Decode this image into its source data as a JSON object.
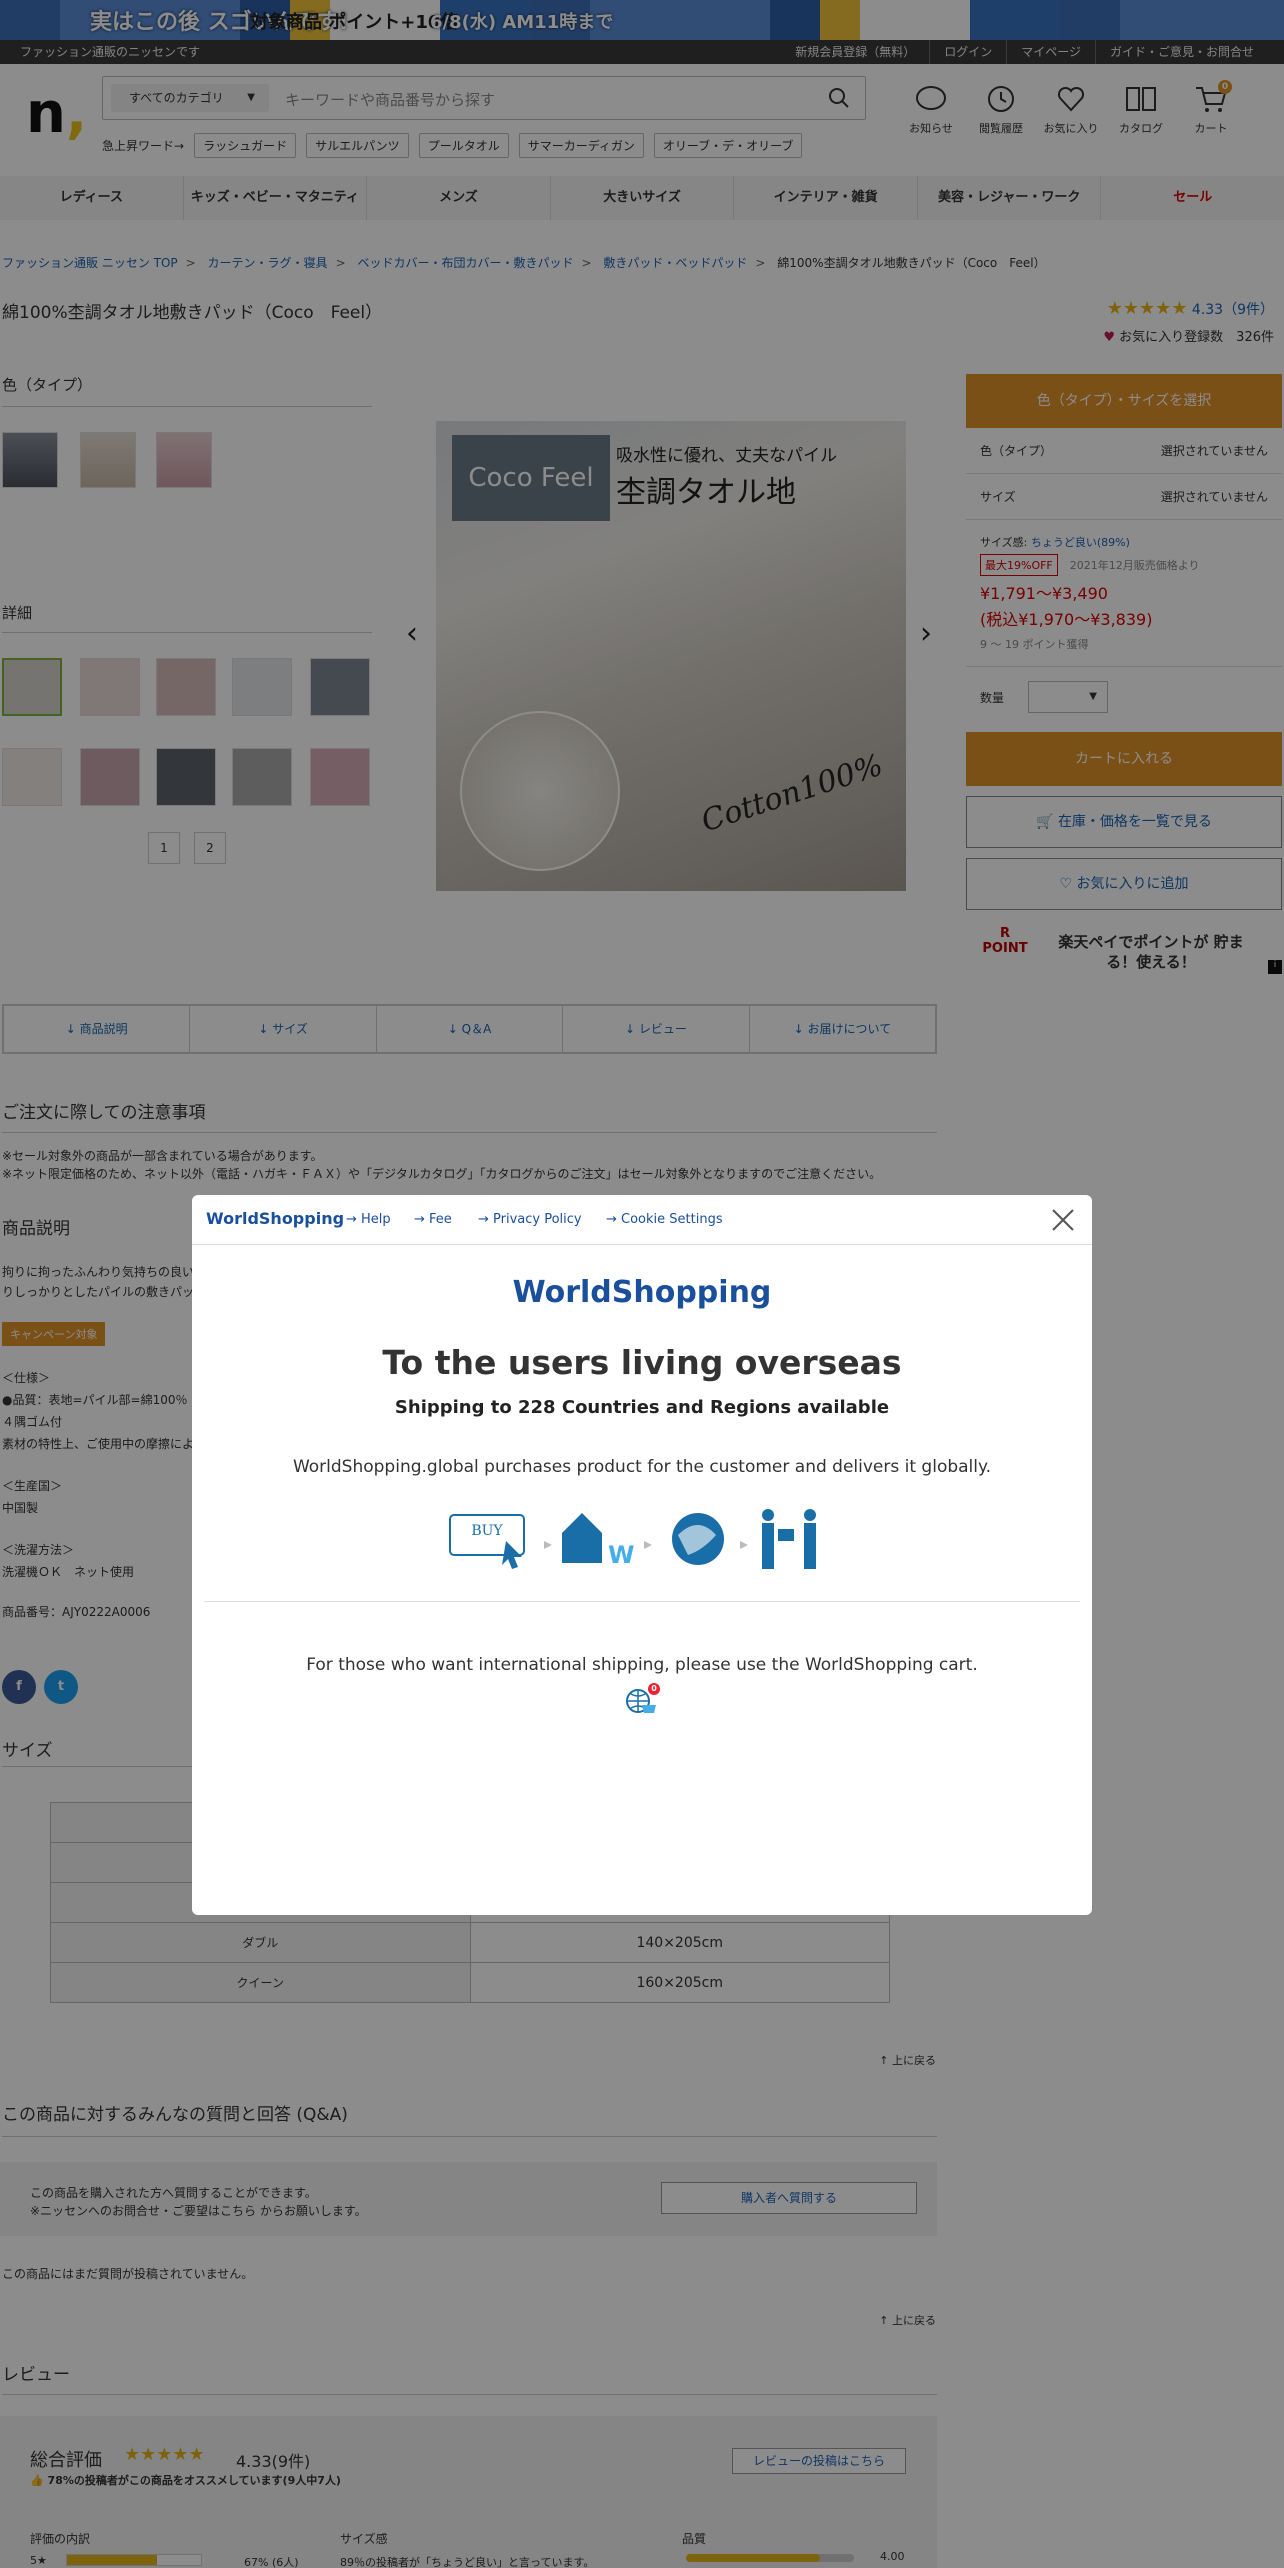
{
  "banner": {
    "phrase": "実はこの後 スゴいんです!",
    "points": "対象商品 ポイント+10倍",
    "date": "6/8(水) AM11時まで"
  },
  "topbar": {
    "message": "ファッション通販のニッセンです",
    "links": [
      "新規会員登録（無料）",
      "ログイン",
      "マイページ",
      "ガイド・ご意見・お問合せ"
    ]
  },
  "header": {
    "logo": "n",
    "category_select": "すべてのカテゴリ",
    "search_placeholder": "キーワードや商品番号から探す",
    "hotwords_label": "急上昇ワード→",
    "hotwords": [
      "ラッシュガード",
      "サルエルパンツ",
      "プールタオル",
      "サマーカーディガン",
      "オリーブ・デ・オリーブ"
    ],
    "icons": [
      {
        "name": "bell-icon",
        "label": "お知らせ"
      },
      {
        "name": "history-icon",
        "label": "閲覧履歴"
      },
      {
        "name": "heart-icon",
        "label": "お気に入り"
      },
      {
        "name": "catalog-icon",
        "label": "カタログ"
      },
      {
        "name": "cart-icon",
        "label": "カート",
        "badge": "0"
      }
    ]
  },
  "catnav": [
    "レディース",
    "キッズ・ベビー・マタニティ",
    "メンズ",
    "大きいサイズ",
    "インテリア・雑貨",
    "美容・レジャー・ワーク",
    "セール"
  ],
  "breadcrumb": [
    "ファッション通販 ニッセン TOP",
    "カーテン・ラグ・寝具",
    "ベッドカバー・布団カバー・敷きパッド",
    "敷きパッド・ベッドパッド",
    "綿100%杢調タオル地敷きパッド（Coco　Feel）"
  ],
  "product": {
    "title": "綿100%杢調タオル地敷きパッド（Coco　Feel）",
    "rating": "4.33（9件）",
    "favorites": "お気に入り登録数　326件",
    "color_heading": "色（タイプ）",
    "detail_heading": "詳細",
    "pages": [
      "1",
      "2"
    ],
    "image": {
      "brand": "Coco Feel",
      "catch1": "吸水性に優れ、丈夫なパイル",
      "catch2": "杢調タオル地",
      "script": "Cotton100%"
    }
  },
  "sidebar": {
    "select_button": "色（タイプ）・サイズを選択",
    "rows": [
      {
        "label": "色（タイプ）",
        "value": "選択されていません"
      },
      {
        "label": "サイズ",
        "value": "選択されていません"
      }
    ],
    "size_feel_label": "サイズ感:",
    "size_feel": "ちょうど良い(89%)",
    "discount_badge": "最大19%OFF",
    "price_note": "2021年12月販売価格より",
    "price": "¥1,791～¥3,490",
    "price_tax": "(税込¥1,970～¥3,839)",
    "points": "9 ～ 19 ポイント獲得",
    "qty_label": "数量",
    "cart_button": "カートに入れる",
    "stock_button": "在庫・価格を一覧で見る",
    "fav_button": "お気に入りに追加",
    "rakuten_text": "楽天ペイでポイントが 貯まる！使える！",
    "rakuten_logo": "R POINT"
  },
  "tabs": [
    "商品説明",
    "サイズ",
    "Q＆A",
    "レビュー",
    "お届けについて"
  ],
  "notes": {
    "heading": "ご注文に際しての注意事項",
    "line1": "※セール対象外の商品が一部含まれている場合があります。",
    "line2": "※ネット限定価格のため、ネット以外（電話・ハガキ・ＦＡＸ）や「デジタルカタログ」「カタログからのご注文」はセール対象外となりますのでご注意ください。"
  },
  "description": {
    "heading": "商品説明",
    "text1": "拘りに拘ったふんわり気持ちの良い",
    "text2": "りしっかりとしたパイルの敷きパッ",
    "campaign": "キャンペーン対象",
    "spec_heading": "＜仕様＞",
    "spec1": "●品質：表地=パイル部=綿100％・",
    "spec2": "４隅ゴム付",
    "spec3": "素材の特性上、ご使用中の摩擦によ",
    "origin_heading": "＜生産国＞",
    "origin": "中国製",
    "wash_heading": "＜洗濯方法＞",
    "wash": "洗濯機ＯＫ　ネット使用",
    "item_no": "商品番号：AJY0222A0006"
  },
  "size": {
    "heading": "サイズ",
    "rows": [
      {
        "label": "",
        "value": ""
      },
      {
        "label": "",
        "value": ""
      },
      {
        "label": "",
        "value": ""
      },
      {
        "label": "ダブル",
        "value": "140×205cm"
      },
      {
        "label": "クイーン",
        "value": "160×205cm"
      }
    ],
    "back_top": "上に戻る"
  },
  "qa": {
    "heading": "この商品に対するみんなの質問と回答 (Q&A)",
    "line1": "この商品を購入された方へ質問することができます。",
    "line2": "※ニッセンへのお問合せ・ご要望はこちら からお願いします。",
    "button": "購入者へ質問する",
    "empty": "この商品にはまだ質問が投稿されていません。",
    "back_top": "上に戻る"
  },
  "review": {
    "heading": "レビュー",
    "overall_label": "総合評価",
    "overall_score": "4.33(9件)",
    "recommend": "78%の投稿者がこの商品をオススメしています(9人中7人)",
    "post_button": "レビューの投稿はこちら",
    "breakdown_label": "評価の内訳",
    "five_star": "5★",
    "five_pct": "67% (6人)",
    "five_fraction": 0.67,
    "size_label": "サイズ感",
    "size_text": "89％の投稿者が「ちょうど良い」と言っています。",
    "quality_label": "品質",
    "quality_score": "4.00"
  },
  "modal": {
    "logo": "WorldShopping",
    "links": [
      "Help",
      "Fee",
      "Privacy Policy",
      "Cookie Settings"
    ],
    "title": "To the users living overseas",
    "subtitle": "Shipping to 228 Countries and Regions available",
    "desc": "WorldShopping.global purchases product for the customer and delivers it globally.",
    "step_buy": "BUY",
    "note": "For those who want international shipping, please use the WorldShopping cart.",
    "cart_badge": "0"
  }
}
